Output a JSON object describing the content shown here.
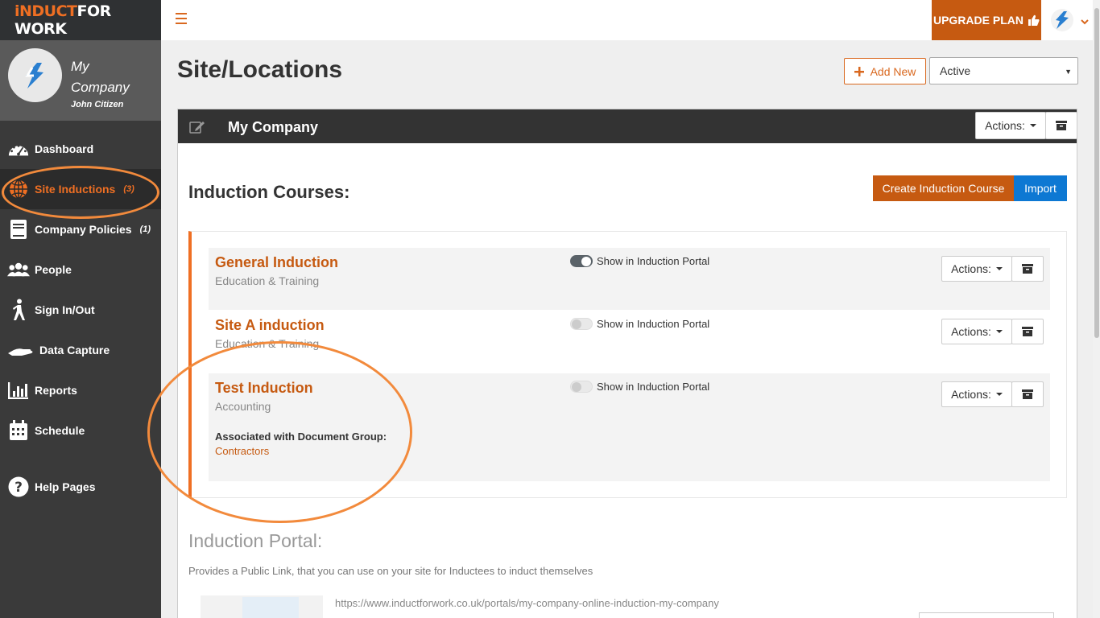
{
  "app": {
    "logo_part1": "iNDUCT",
    "logo_part2": "FOR WORK"
  },
  "profile": {
    "company_name": "My Company",
    "user_name": "John Citizen"
  },
  "sidebar": {
    "items": [
      {
        "label": "Dashboard",
        "icon": "dashboard-gauge-icon",
        "count": ""
      },
      {
        "label": "Site Inductions",
        "icon": "globe-icon",
        "count": "(3)",
        "active": true
      },
      {
        "label": "Company Policies",
        "icon": "book-icon",
        "count": "(1)"
      },
      {
        "label": "People",
        "icon": "people-icon",
        "count": ""
      },
      {
        "label": "Sign In/Out",
        "icon": "walking-person-icon",
        "count": ""
      },
      {
        "label": "Data Capture",
        "icon": "hand-icon",
        "count": ""
      },
      {
        "label": "Reports",
        "icon": "bar-chart-icon",
        "count": ""
      },
      {
        "label": "Schedule",
        "icon": "calendar-icon",
        "count": ""
      },
      {
        "label": "Help Pages",
        "icon": "question-circle-icon",
        "count": ""
      }
    ]
  },
  "topbar": {
    "upgrade_label": "UPGRADE PLAN"
  },
  "page": {
    "title": "Site/Locations",
    "add_new_label": "Add New",
    "status_value": "Active"
  },
  "panel": {
    "title": "My Company",
    "actions_label": "Actions:"
  },
  "courses": {
    "heading": "Induction Courses:",
    "create_label": "Create Induction Course",
    "import_label": "Import",
    "toggle_label": "Show in Induction Portal",
    "actions_label": "Actions:",
    "items": [
      {
        "title": "General Induction",
        "category": "Education & Training",
        "show_in_portal": true
      },
      {
        "title": "Site A induction",
        "category": "Education & Training",
        "show_in_portal": false
      },
      {
        "title": "Test Induction",
        "category": "Accounting",
        "show_in_portal": false,
        "assoc_label": "Associated with Document Group:",
        "assoc_value": "Contractors"
      }
    ]
  },
  "portal": {
    "heading": "Induction Portal:",
    "description": "Provides a Public Link, that you can use on your site for Inductees to induct themselves",
    "url": "https://www.inductforwork.co.uk/portals/my-company-online-induction-my-company"
  },
  "colors": {
    "brand_orange": "#c65a11",
    "accent_orange": "#ef6f23",
    "import_blue": "#0d78d3",
    "sidebar_bg": "#3a3a3a",
    "annotation": "#f28a3c"
  }
}
